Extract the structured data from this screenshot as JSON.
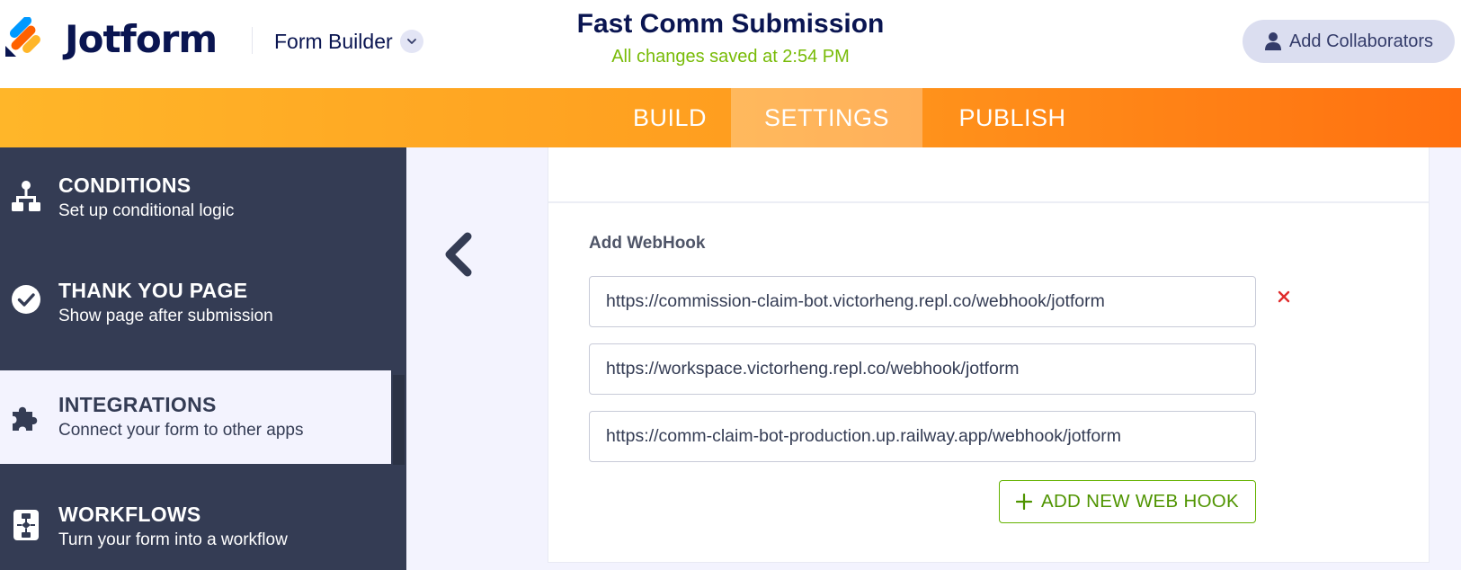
{
  "header": {
    "logo_text": "Jotform",
    "builder_label": "Form Builder",
    "form_title": "Fast Comm Submission",
    "save_status": "All changes saved at 2:54 PM",
    "collaborators_label": "Add Collaborators"
  },
  "tabs": [
    {
      "label": "BUILD"
    },
    {
      "label": "SETTINGS",
      "active": true
    },
    {
      "label": "PUBLISH"
    }
  ],
  "sidebar": {
    "items": [
      {
        "title": "CONDITIONS",
        "subtitle": "Set up conditional logic",
        "icon": "conditions-icon"
      },
      {
        "title": "THANK YOU PAGE",
        "subtitle": "Show page after submission",
        "icon": "check-circle-icon"
      },
      {
        "title": "INTEGRATIONS",
        "subtitle": "Connect your form to other apps",
        "icon": "puzzle-icon",
        "active": true
      },
      {
        "title": "WORKFLOWS",
        "subtitle": "Turn your form into a workflow",
        "icon": "workflow-icon"
      }
    ]
  },
  "webhooks": {
    "section_label": "Add WebHook",
    "urls": [
      "https://commission-claim-bot.victorheng.repl.co/webhook/jotform",
      "https://workspace.victorheng.repl.co/webhook/jotform",
      "https://comm-claim-bot-production.up.railway.app/webhook/jotform"
    ],
    "add_button_label": "ADD NEW WEB HOOK"
  },
  "colors": {
    "brand_navy": "#0a1551",
    "tab_gradient_start": "#ffb629",
    "tab_gradient_end": "#ff7010",
    "sidebar_bg": "#343c54",
    "save_green": "#78bb07",
    "add_button_green": "#4f9400",
    "remove_red": "#e02b2b"
  }
}
